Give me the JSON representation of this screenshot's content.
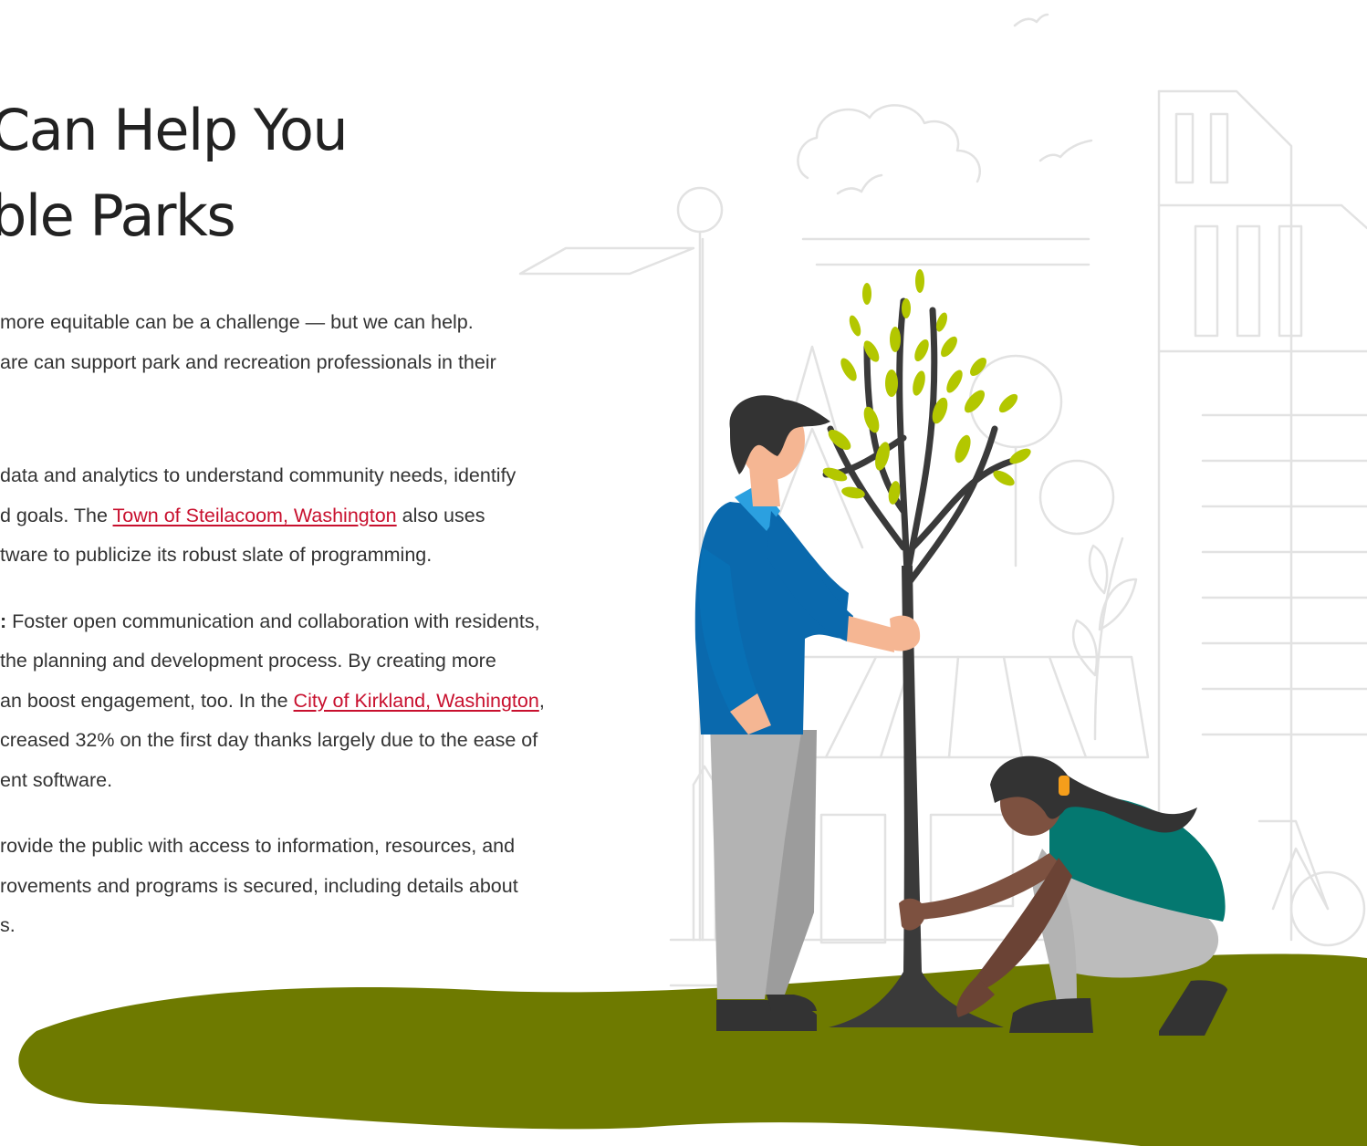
{
  "heading": {
    "line1": "Can Help You",
    "line2": "ble Parks"
  },
  "paragraphs": {
    "p1": {
      "line1": "more equitable can be a challenge — but we can help.",
      "line2": "are can support park and recreation professionals in their"
    },
    "p2": {
      "line1": "data and analytics to understand community needs, identify",
      "line2_prefix": "d goals. The ",
      "line2_link": "Town of Steilacoom, Washington",
      "line2_suffix": " also uses",
      "line3": "tware to publicize its robust slate of programming."
    },
    "p3": {
      "line1_bold": ":",
      "line1_rest": " Foster open communication and collaboration with residents,",
      "line2": "the planning and development process. By creating more",
      "line3_prefix": "an boost engagement, too. In the ",
      "line3_link": "City of Kirkland, Washington",
      "line3_suffix": ",",
      "line4": "creased 32% on the first day thanks largely due to the ease of",
      "line5": "ent software."
    },
    "p4": {
      "line1": "rovide the public with access to information, resources, and",
      "line2": "rovements and programs is secured, including details about",
      "line3": "s."
    }
  },
  "colors": {
    "link": "#c8102e",
    "ground": "#6e7a00",
    "shirt_man": "#0a69ad",
    "shirt_woman": "#047870",
    "leaf": "#b3c700",
    "trunk": "#3a3a3a",
    "line_art": "#e0e0e0"
  }
}
